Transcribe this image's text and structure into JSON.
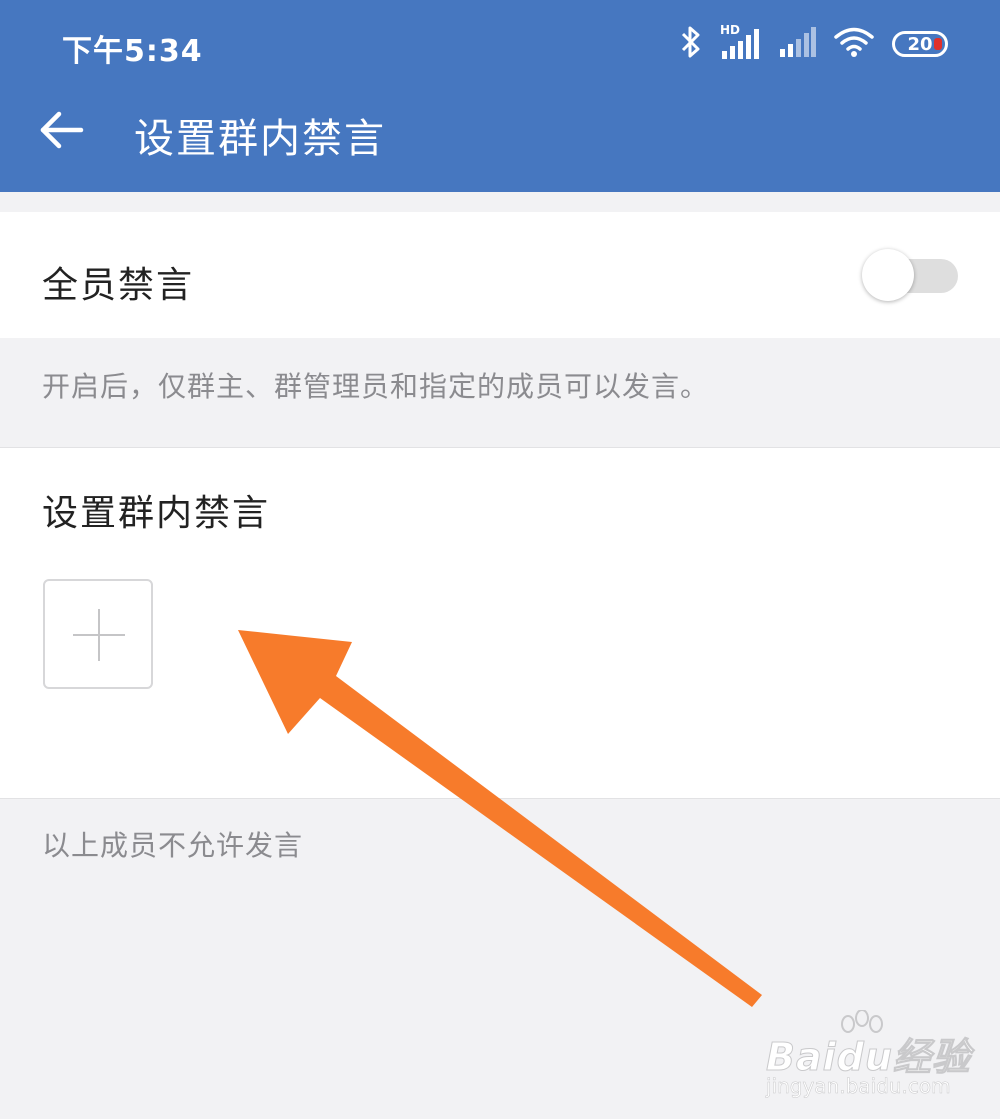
{
  "status_bar": {
    "time": "下午5:34",
    "network_label": "HD",
    "battery_level": "20",
    "icons": [
      "bluetooth-icon",
      "signal-icon",
      "wifi-icon",
      "battery-icon"
    ]
  },
  "header": {
    "title": "设置群内禁言",
    "background_color": "#4677c0"
  },
  "mute_all": {
    "label": "全员禁言",
    "enabled": false,
    "hint": "开启后，仅群主、群管理员和指定的成员可以发言。"
  },
  "group_mute": {
    "label": "设置群内禁言",
    "add_icon": "plus-icon",
    "footer_note": "以上成员不允许发言"
  },
  "annotation": {
    "arrow_color": "#f77b2b"
  },
  "watermark": {
    "brand": "Baidu经验",
    "url": "jingyan.baidu.com"
  }
}
